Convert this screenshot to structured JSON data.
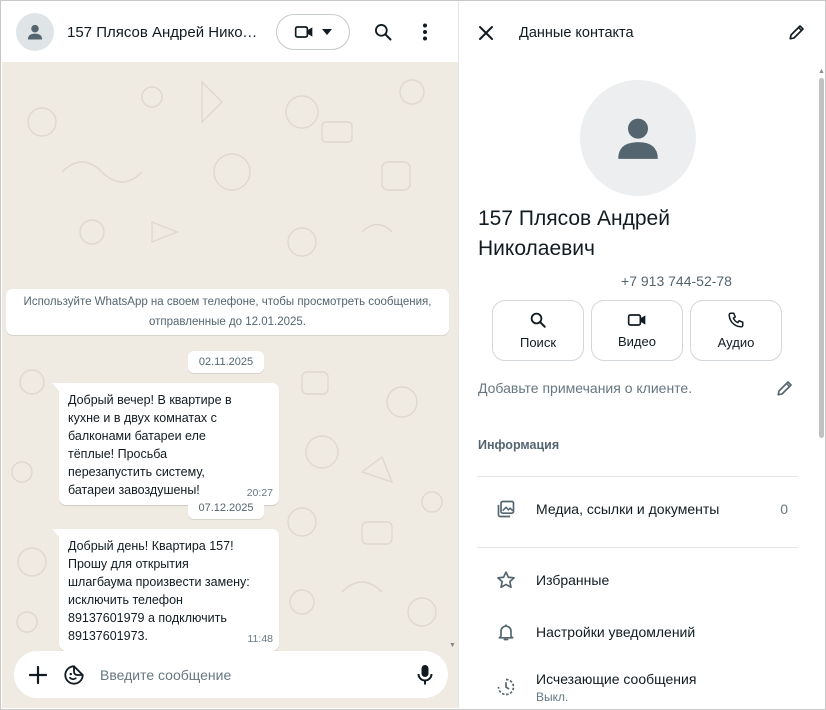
{
  "chat": {
    "header": {
      "title": "157 Плясов Андрей Николаевич",
      "avatar_icon": "person-icon",
      "video_icon": "video-camera-icon",
      "dropdown_icon": "caret-down-icon",
      "search_icon": "search-icon",
      "menu_icon": "kebab-menu-icon"
    },
    "encryption_note": {
      "line1": "Используйте WhatsApp на своем телефоне, чтобы просмотреть сообщения,",
      "line2": "отправленные до 12.01.2025."
    },
    "dates": [
      "02.11.2025",
      "07.12.2025"
    ],
    "messages": [
      {
        "text": "Добрый вечер!  В квартире в кухне и в двух комнатах с балконами батареи еле тёплые! Просьба перезапустить систему, батареи завоздушены!",
        "time": "20:27"
      },
      {
        "text": "Добрый день!  Квартира 157! Прошу для открытия шлагбаума произвести замену: исключить телефон 89137601979 а подключить 89137601973.",
        "time": "11:48"
      }
    ],
    "composer": {
      "placeholder": "Введите сообщение",
      "attach_icon": "plus-icon",
      "sticker_icon": "sticker-icon",
      "mic_icon": "microphone-icon"
    }
  },
  "contact": {
    "header": {
      "title": "Данные контакта",
      "close_icon": "close-icon",
      "edit_icon": "pencil-icon"
    },
    "name_line1": "157 Плясов Андрей",
    "name_line2": "Николаевич",
    "phone": "+7 913 744-52-78",
    "actions": [
      {
        "label": "Поиск",
        "icon": "search-icon"
      },
      {
        "label": "Видео",
        "icon": "video-camera-icon"
      },
      {
        "label": "Аудио",
        "icon": "phone-icon"
      }
    ],
    "note_placeholder": "Добавьте примечания о клиенте.",
    "info_section_title": "Информация",
    "rows": [
      {
        "label": "Медиа, ссылки и документы",
        "count": "0",
        "icon": "media-gallery-icon"
      },
      {
        "label": "Избранные",
        "icon": "star-icon"
      },
      {
        "label": "Настройки уведомлений",
        "icon": "bell-icon"
      },
      {
        "label": "Исчезающие сообщения",
        "sub": "Выкл.",
        "icon": "disappearing-timer-icon"
      }
    ]
  },
  "colors": {
    "chat_background": "#efeae2",
    "bubble": "#ffffff",
    "icon": "#54656f",
    "text_primary": "#111b21",
    "text_secondary": "#667781"
  }
}
